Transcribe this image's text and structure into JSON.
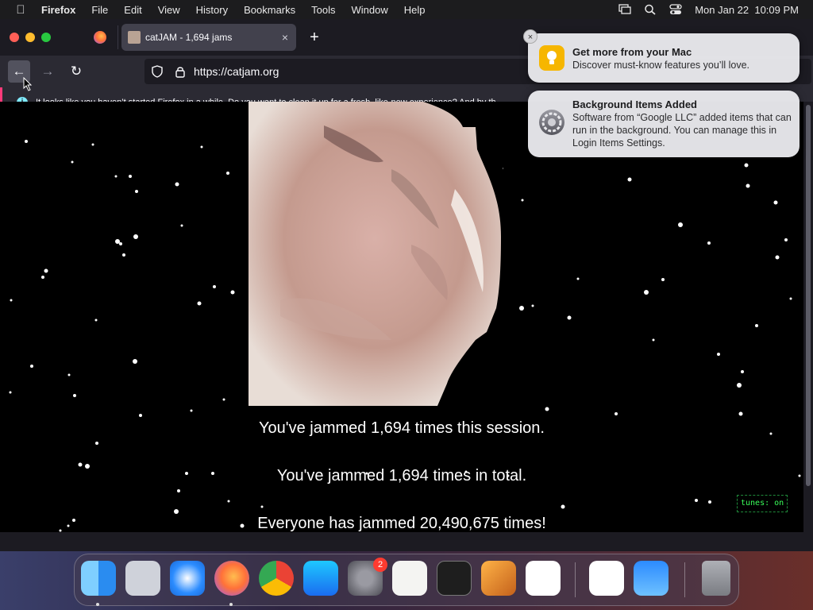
{
  "menubar": {
    "apple_icon": "apple-icon",
    "items": [
      "Firefox",
      "File",
      "Edit",
      "View",
      "History",
      "Bookmarks",
      "Tools",
      "Window",
      "Help"
    ],
    "datetime": "Mon Jan 22  10:09 PM",
    "status_icons": [
      "screen-mirroring-icon",
      "spotlight-search-icon",
      "control-center-icon"
    ]
  },
  "browser": {
    "tab": {
      "title": "catJAM - 1,694 jams",
      "close": "×"
    },
    "new_tab": "+",
    "nav": {
      "back": "←",
      "forward": "→",
      "reload": "↻"
    },
    "url": "https://catjam.org",
    "infobar": {
      "icon": "i",
      "message": "It looks like you haven’t started Firefox in a while. Do you want to clean it up for a fresh, like-new experience? And by th"
    }
  },
  "page": {
    "counter_session": "You've jammed 1,694 times this session.",
    "counter_total": "You've jammed 1,694 times in total.",
    "counter_everyone": "Everyone has jammed 20,490,675 times!",
    "tunes": "tunes: on"
  },
  "notifications": [
    {
      "title": "Get more from your Mac",
      "body": "Discover must-know features you’ll love.",
      "icon": "lightbulb-icon"
    },
    {
      "title": "Background Items Added",
      "body": "Software from “Google LLC” added items that can run in the background. You can manage this in Login Items Settings.",
      "icon": "gear-icon"
    }
  ],
  "notification_close": "×",
  "dock": {
    "apps": [
      "Finder",
      "Launchpad",
      "Safari",
      "Firefox",
      "Chrome",
      "App Store",
      "System Settings",
      "TextEdit",
      "Terminal",
      "GarageBand",
      "Visual Studio Code",
      "Visual Studio",
      "Weather",
      "Trash"
    ],
    "system_settings_badge": "2"
  }
}
